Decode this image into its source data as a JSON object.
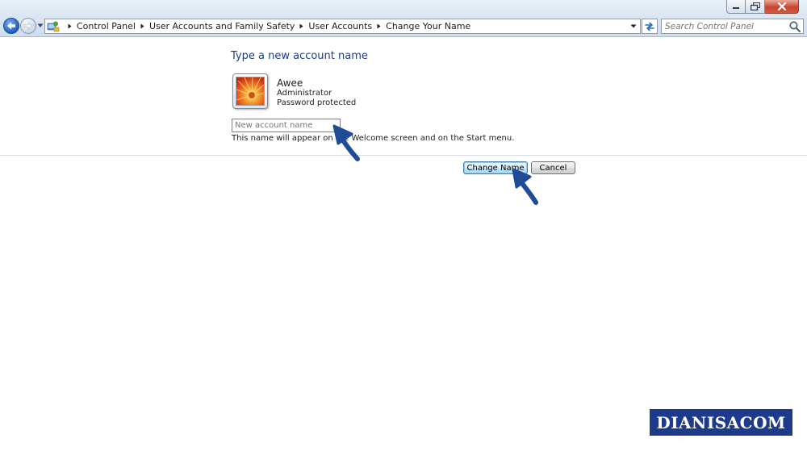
{
  "window": {
    "caption_buttons": {
      "minimize": "minimize",
      "maximize": "maximize",
      "close": "close"
    }
  },
  "navigation": {
    "breadcrumbs": [
      {
        "label": "Control Panel"
      },
      {
        "label": "User Accounts and Family Safety"
      },
      {
        "label": "User Accounts"
      },
      {
        "label": "Change Your Name"
      }
    ],
    "search_placeholder": "Search Control Panel"
  },
  "content": {
    "heading": "Type a new account name",
    "user": {
      "name": "Awee",
      "role": "Administrator",
      "status": "Password protected"
    },
    "input_placeholder": "New account name",
    "hint": "This name will appear on the Welcome screen and on the Start menu."
  },
  "buttons": {
    "change_name": "Change Name",
    "cancel": "Cancel"
  },
  "watermark": "DIANISACOM",
  "colors": {
    "heading": "#1e3c87",
    "watermark_bg": "#1d3b8a",
    "annotation_arrow": "#1f4c96"
  }
}
